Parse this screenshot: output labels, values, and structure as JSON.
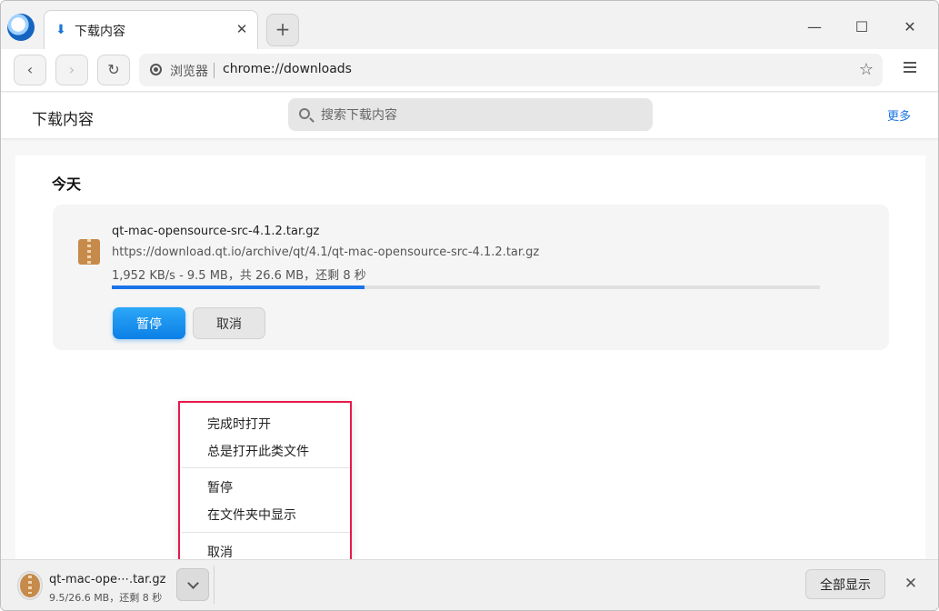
{
  "tab": {
    "title": "下载内容",
    "icon": "download-icon",
    "close": "✕"
  },
  "tabstrip": {
    "new_tab": "+"
  },
  "window_controls": {
    "minimize": "—",
    "maximize": "☐",
    "close": "✕"
  },
  "toolbar": {
    "back": "‹",
    "forward": "›",
    "reload": "↻",
    "site_label": "浏览器",
    "url": "chrome://downloads",
    "star": "☆"
  },
  "header": {
    "title": "下载内容",
    "search_placeholder": "搜索下载内容",
    "more": "更多"
  },
  "downloads": {
    "day_heading": "今天",
    "items": [
      {
        "file_name": "qt-mac-opensource-src-4.1.2.tar.gz",
        "url": "https://download.qt.io/archive/qt/4.1/qt-mac-opensource-src-4.1.2.tar.gz",
        "status": "1,952 KB/s - 9.5 MB，共 26.6 MB，还剩 8 秒",
        "progress": 0.357,
        "pause_label": "暂停",
        "cancel_label": "取消"
      }
    ]
  },
  "context_menu": {
    "items": [
      "完成时打开",
      "总是打开此类文件",
      "暂停",
      "在文件夹中显示",
      "取消"
    ]
  },
  "shelf": {
    "file_name": "qt-mac-ope⋯.tar.gz",
    "status": "9.5/26.6 MB，还剩 8 秒",
    "show_all": "全部显示",
    "close": "✕"
  },
  "colors": {
    "accent": "#1a73e8",
    "primary_button": "#0b7fe6",
    "menu_highlight_border": "#e8194a",
    "file_icon": "#c68a4a"
  }
}
